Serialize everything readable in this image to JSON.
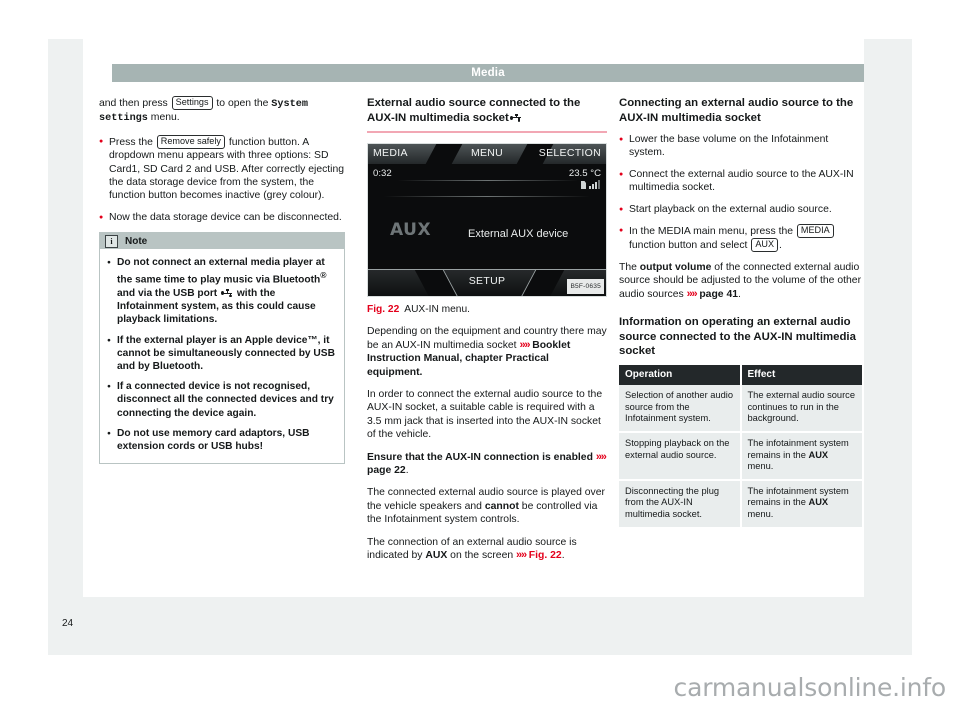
{
  "document": {
    "running_head": "Media",
    "page_number": "24",
    "watermark": "carmanualsonline.info"
  },
  "left_column": {
    "intro": {
      "before_key": "and then press ",
      "key_label": "Settings",
      "after_key": " to open the ",
      "menu_name": "System settings",
      "tail": " menu."
    },
    "bullet_remove_safely": {
      "before_key": "Press the ",
      "key_label": "Remove safely",
      "after_key": " function button. A dropdown menu appears with three options: SD Card1, SD Card 2 and USB. After correctly ejecting the data storage device from the system, the function button becomes inactive (grey colour)."
    },
    "bullet_disconnect": "Now the data storage device can be disconnected.",
    "note_box": {
      "title": "Note",
      "icon": "info-icon",
      "items": [
        {
          "part1": "Do not connect an external media player at the same time to play music via Bluetooth",
          "sup": "®",
          "part2": " and via the USB port ",
          "icon": "usb-icon",
          "part3": " with the Infotainment system, as this could cause playback limitations."
        },
        {
          "text": "If the external player is an Apple device™, it cannot be simultaneously connected by USB and by Bluetooth."
        },
        {
          "text": "If a connected device is not recognised, disconnect all the connected devices and try connecting the device again."
        },
        {
          "text": "Do not use memory card adaptors, USB extension cords or USB hubs!"
        }
      ]
    }
  },
  "middle_column": {
    "heading": "External audio source connected to the AUX-IN multimedia socket",
    "heading_icon": "usb-icon",
    "figure": {
      "caption_number": "Fig. 22",
      "caption_text": "AUX-IN menu.",
      "image_code": "B5F-0635",
      "screen": {
        "top_left_label": "MEDIA",
        "top_center_label": "MENU",
        "top_right_label": "SELECTION",
        "time": "0:32",
        "temperature": "23.5 °C",
        "source_label": "AUX",
        "device_label": "External AUX device",
        "bottom_label": "SETUP",
        "status_icons": [
          "sim-card-icon",
          "signal-bars-icon"
        ]
      }
    },
    "para_1": {
      "text": "Depending on the equipment and country there may be an AUX-IN multimedia socket ",
      "xref": "Booklet Instruction Manual, chapter Practical equipment",
      "tail": "."
    },
    "para_2": "In order to connect the external audio source to the AUX-IN socket, a suitable cable is required with a 3.5 mm jack that is inserted into the AUX-IN socket of the vehicle.",
    "para_3": {
      "bold": "Ensure that the AUX-IN connection is enabled ",
      "xref": "page 22",
      "tail": "."
    },
    "para_4": {
      "part1": "The connected external audio source is played over the vehicle speakers and ",
      "bold": "cannot",
      "part2": " be controlled via the Infotainment system controls."
    },
    "para_5": {
      "part1": "The connection of an external audio source is indicated by ",
      "bold": "AUX",
      "part2": " on the screen ",
      "xref": "Fig. 22",
      "tail": "."
    }
  },
  "right_column": {
    "heading_1": "Connecting an external audio source to the AUX-IN multimedia socket",
    "bullets": [
      "Lower the base volume on the Infotainment system.",
      "Connect the external audio source to the AUX-IN multimedia socket.",
      "Start playback on the external audio source."
    ],
    "bullet_media": {
      "before_key": "In the MEDIA main menu, press the ",
      "key_label": "MEDIA",
      "mid": " function button and select ",
      "key_label_2": "AUX",
      "tail": "."
    },
    "para_volume": {
      "part1": "The ",
      "bold": "output volume",
      "part2": " of the connected external audio source should be adjusted to the volume of the other audio sources ",
      "xref": "page 41",
      "tail": "."
    },
    "heading_2": "Information on operating an external audio source connected to the AUX-IN multimedia socket",
    "table": {
      "columns": [
        "Operation",
        "Effect"
      ],
      "rows": [
        {
          "operation": "Selection of another audio source from the Infotainment system.",
          "effect": "The external audio source continues to run in the background."
        },
        {
          "operation": "Stopping playback on the external audio source.",
          "effect_part1": "The infotainment system remains in the ",
          "effect_bold": "AUX",
          "effect_part2": " menu."
        },
        {
          "operation": "Disconnecting the plug from the AUX-IN multimedia socket.",
          "effect_part1": "The infotainment system remains in the ",
          "effect_bold": "AUX",
          "effect_part2": " menu."
        }
      ]
    }
  },
  "colors": {
    "accent_red": "#e3001b",
    "running_head_bg": "#a6b4b3",
    "table_header_bg": "#23282a",
    "table_cell_bg": "#e9eded",
    "note_header_bg": "#b9c4c3"
  }
}
